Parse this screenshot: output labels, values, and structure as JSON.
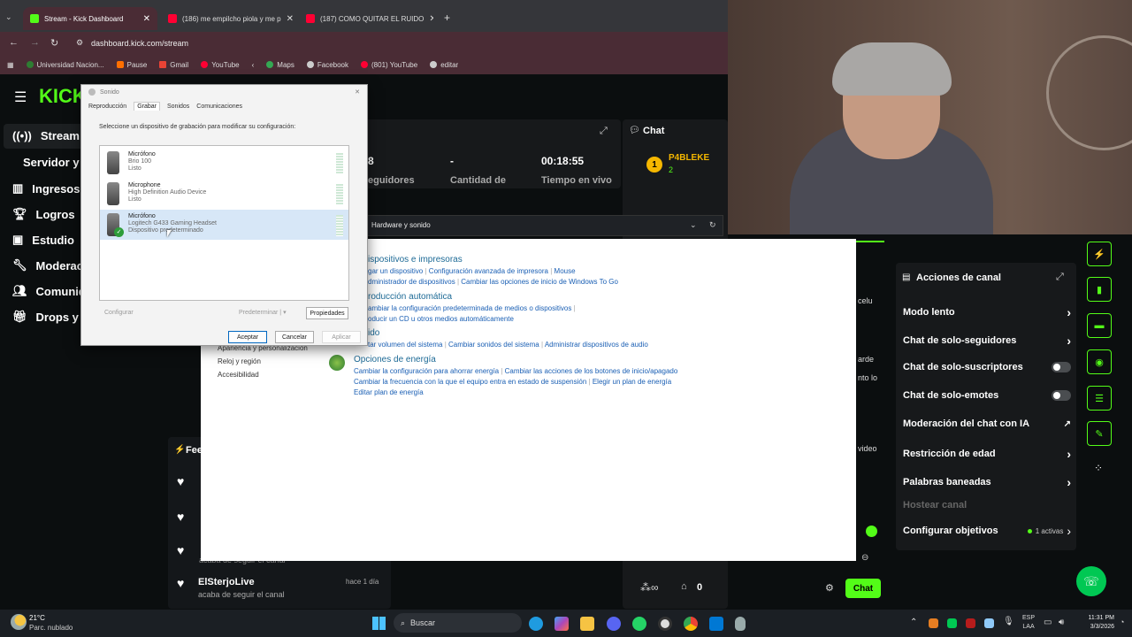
{
  "browser": {
    "tabs": [
      {
        "title": "Stream - Kick Dashboard",
        "color": "#53fc18"
      },
      {
        "title": "(186) me empilcho piola y me p",
        "color": "#ff0033"
      },
      {
        "title": "(187) COMO QUITAR EL RUIDO",
        "color": "#ff0033"
      }
    ],
    "url": "dashboard.kick.com/stream",
    "bookmarks": [
      "Universidad Nacion...",
      "Pause",
      "Gmail",
      "YouTube",
      "Maps",
      "Facebook",
      "(801) YouTube",
      "editar"
    ]
  },
  "sidebar": {
    "logo": "KICK",
    "items": [
      "Stream",
      "Servidor y c",
      "Ingresos",
      "Logros",
      "Estudio",
      "Moderaci",
      "Comunid",
      "Drops y r"
    ]
  },
  "stats": {
    "followers_value": "8",
    "followers_label": "eguidores",
    "amount_value": "-",
    "amount_label": "Cantidad de",
    "time_value": "00:18:55",
    "time_label": "Tiempo en vivo"
  },
  "chat": {
    "title": "Chat",
    "badge_num": "1",
    "user": "P4BLEKE",
    "user_sub": "2",
    "peek_lines": [
      "celu",
      "arde",
      "nto lo",
      "video"
    ],
    "send_label": "Chat",
    "counter_value": "0"
  },
  "actions": {
    "title": "Acciones de canal",
    "rows": [
      {
        "label": "Modo lento",
        "ctl": "arrow"
      },
      {
        "label": "Chat de solo-seguidores",
        "ctl": "arrow"
      },
      {
        "label": "Chat de solo-suscriptores",
        "ctl": "toggle"
      },
      {
        "label": "Chat de solo-emotes",
        "ctl": "toggle"
      },
      {
        "label": "Moderación del chat con IA",
        "ctl": "ext"
      },
      {
        "label": "Restricción de edad",
        "ctl": "arrow"
      },
      {
        "label": "Palabras baneadas",
        "ctl": "arrow"
      }
    ],
    "host_label": "Hostear canal",
    "goals_label": "Configurar objetivos",
    "goals_badge": "1 activas"
  },
  "feed": {
    "title": "Fee",
    "last_user": "ElSterjoLive",
    "last_action": "acaba de seguir el canal",
    "last_time": "hace 1 día",
    "clipped_text": "acaba de seguir el canal"
  },
  "control_panel": {
    "breadcrumb": "Hardware y sonido",
    "left_links": [
      "Apariencia y personalización",
      "Reloj y región",
      "Accesibilidad"
    ],
    "s1_title": "ispositivos e impresoras",
    "s1_links": [
      "gar un dispositivo",
      "Configuración avanzada de impresora",
      "Mouse",
      "dministrador de dispositivos",
      "Cambiar las opciones de inicio de Windows To Go"
    ],
    "s2_title": "roducción automática",
    "s2_links": [
      "ambiar la configuración predeterminada de medios o dispositivos",
      "oducir un CD u otros medios automáticamente"
    ],
    "s3_title": "ido",
    "s3_links": [
      "tar volumen del sistema",
      "Cambiar sonidos del sistema",
      "Administrar dispositivos de audio"
    ],
    "s4_title": "Opciones de energía",
    "s4_links": [
      "Cambiar la configuración para ahorrar energía",
      "Cambiar las acciones de los botones de inicio/apagado",
      "Cambiar la frecuencia con la que el equipo entra en estado de suspensión",
      "Elegir un plan de energía",
      "Editar plan de energía"
    ]
  },
  "sound_dialog": {
    "title": "Sonido",
    "tabs": [
      "Reproducción",
      "Grabar",
      "Sonidos",
      "Comunicaciones"
    ],
    "instruction": "Seleccione un dispositivo de grabación para modificar su configuración:",
    "devices": [
      {
        "name": "Micrófono",
        "desc": "Brio 100",
        "status": "Listo"
      },
      {
        "name": "Microphone",
        "desc": "High Definition Audio Device",
        "status": "Listo"
      },
      {
        "name": "Micrófono",
        "desc": "Logitech G433 Gaming Headset",
        "status": "Dispositivo predeterminado"
      }
    ],
    "configure": "Configurar",
    "set_default": "Predeterminar",
    "properties": "Propiedades",
    "ok": "Aceptar",
    "cancel": "Cancelar",
    "apply": "Aplicar"
  },
  "taskbar": {
    "temp": "21°C",
    "weather": "Parc. nublado",
    "search": "Buscar",
    "lang1": "ESP",
    "lang2": "LAA",
    "time": "11:31 PM",
    "date": "3/3/2026"
  }
}
